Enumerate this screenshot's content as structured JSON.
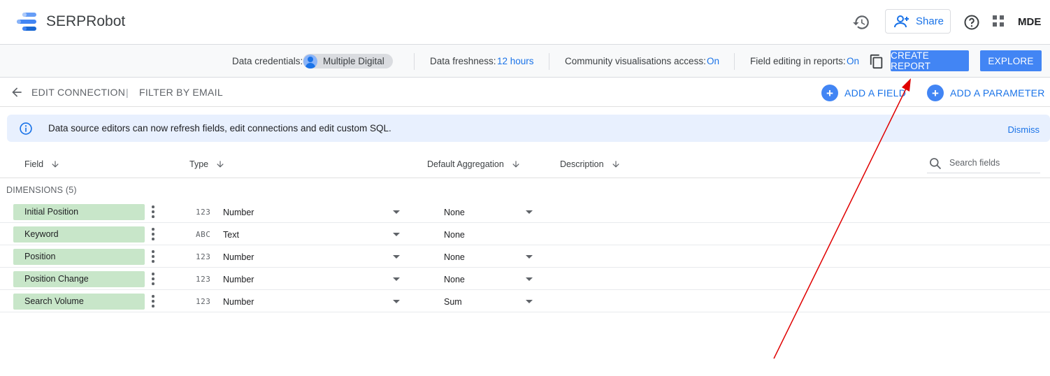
{
  "header": {
    "app_title": "SERPRobot",
    "share_label": "Share",
    "user_initials": "MDE"
  },
  "toolbar": {
    "credentials_label": "Data credentials:",
    "credentials_value": "Multiple Digital",
    "freshness_label": "Data freshness:",
    "freshness_value": "12 hours",
    "community_label": "Community visualisations access:",
    "community_value": "On",
    "field_editing_label": "Field editing in reports:",
    "field_editing_value": "On",
    "create_report_label": "CREATE REPORT",
    "explore_label": "EXPLORE"
  },
  "nav": {
    "edit_connection": "EDIT CONNECTION",
    "divider": "|",
    "filter_by_email": "FILTER BY EMAIL",
    "add_field": "ADD A FIELD",
    "add_parameter": "ADD A PARAMETER"
  },
  "banner": {
    "text": "Data source editors can now refresh fields, edit connections and edit custom SQL.",
    "dismiss": "Dismiss"
  },
  "table": {
    "columns": {
      "field": "Field",
      "type": "Type",
      "aggregation": "Default Aggregation",
      "description": "Description"
    },
    "search_placeholder": "Search fields",
    "section_title": "DIMENSIONS (5)",
    "rows": [
      {
        "name": "Initial Position",
        "type_glyph": "123",
        "type": "Number",
        "aggregation": "None",
        "agg_dropdown": true
      },
      {
        "name": "Keyword",
        "type_glyph": "ABC",
        "type": "Text",
        "aggregation": "None",
        "agg_dropdown": false
      },
      {
        "name": "Position",
        "type_glyph": "123",
        "type": "Number",
        "aggregation": "None",
        "agg_dropdown": true
      },
      {
        "name": "Position Change",
        "type_glyph": "123",
        "type": "Number",
        "aggregation": "None",
        "agg_dropdown": true
      },
      {
        "name": "Search Volume",
        "type_glyph": "123",
        "type": "Number",
        "aggregation": "Sum",
        "agg_dropdown": true
      }
    ]
  },
  "colors": {
    "accent": "#1a73e8",
    "button": "#4285f4",
    "field_chip": "#c8e6c9",
    "banner_bg": "#e8f0fe",
    "annotation_arrow": "#e00000"
  }
}
